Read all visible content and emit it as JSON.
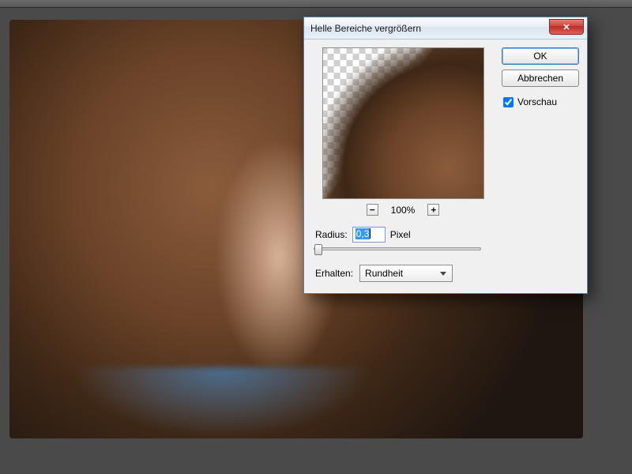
{
  "dialog": {
    "title": "Helle Bereiche vergrößern",
    "close_aria": "Schließen",
    "ok_label": "OK",
    "cancel_label": "Abbrechen",
    "preview_check_label": "Vorschau",
    "preview_checked": true,
    "zoom": {
      "minus_aria": "Verkleinern",
      "percent_label": "100%",
      "plus_aria": "Vergrößern"
    },
    "radius": {
      "label": "Radius:",
      "value": "0,3",
      "unit": "Pixel"
    },
    "preserve": {
      "label": "Erhalten:",
      "selected": "Rundheit"
    }
  }
}
